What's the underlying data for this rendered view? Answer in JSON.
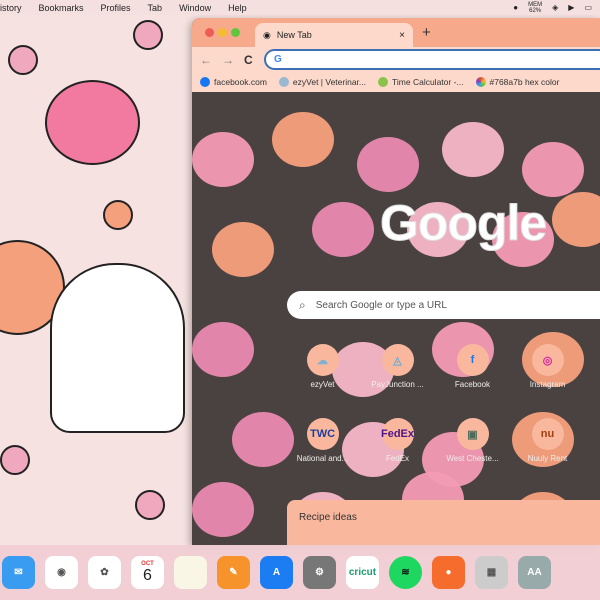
{
  "menubar": {
    "items": [
      "istory",
      "Bookmarks",
      "Profiles",
      "Tab",
      "Window",
      "Help"
    ],
    "mem_label": "MEM",
    "mem_value": "62%"
  },
  "browser": {
    "tab_title": "New Tab",
    "tab_close": "×",
    "new_tab": "+",
    "nav": {
      "back": "←",
      "forward": "→",
      "reload": "C"
    },
    "omnibox": {
      "value": "",
      "icon": "G"
    },
    "bookmarks": [
      {
        "label": "facebook.com",
        "color": "#1877f2"
      },
      {
        "label": "ezyVet | Veterinar...",
        "color": "#9ab8cf"
      },
      {
        "label": "Time Calculator -...",
        "color": "#8bc34a"
      },
      {
        "label": "#768a7b hex color",
        "color": "#e0573a"
      }
    ],
    "logo": "Google",
    "search_placeholder": "Search Google or type a URL",
    "shortcuts": [
      {
        "label": "ezyVet",
        "icon": "☁",
        "color": "#7fb2d0"
      },
      {
        "label": "PayJunction ...",
        "icon": "◬",
        "color": "#6aaed6"
      },
      {
        "label": "Facebook",
        "icon": "f",
        "color": "#1877f2"
      },
      {
        "label": "Instagram",
        "icon": "◎",
        "color": "#d6249f"
      },
      {
        "label": "National and...",
        "icon": "TWC",
        "color": "#1f3f99"
      },
      {
        "label": "FedEx",
        "icon": "FedEx",
        "color": "#4d148c"
      },
      {
        "label": "West Cheste...",
        "icon": "▣",
        "color": "#4c6b5a"
      },
      {
        "label": "Nuuly Rent",
        "icon": "nu",
        "color": "#a0400f"
      }
    ],
    "recipe_title": "Recipe ideas"
  },
  "dock": {
    "apps": [
      {
        "name": "Mail",
        "glyph": "✉",
        "color": "#3a9cf0"
      },
      {
        "name": "Chrome",
        "glyph": "◉",
        "color": "#fff"
      },
      {
        "name": "Photos",
        "glyph": "✿",
        "color": "#fff"
      },
      {
        "name": "Calendar",
        "month": "OCT",
        "day": "6",
        "color": "#fff"
      },
      {
        "name": "Notes",
        "glyph": "",
        "color": "#faf6e6"
      },
      {
        "name": "Pages",
        "glyph": "✎",
        "color": "#f6932b"
      },
      {
        "name": "App Store",
        "glyph": "A",
        "color": "#1c7cf2"
      },
      {
        "name": "System Settings",
        "glyph": "⚙",
        "color": "#777"
      },
      {
        "name": "Cricut",
        "glyph": "cricut",
        "color": "#fff"
      },
      {
        "name": "Spotify",
        "glyph": "≋",
        "color": "#1ed760"
      },
      {
        "name": "Origin",
        "glyph": "●",
        "color": "#f56c2d"
      },
      {
        "name": "Calculator",
        "glyph": "▦",
        "color": "#ccc"
      },
      {
        "name": "Font Book",
        "glyph": "AA",
        "color": "#9aa"
      }
    ]
  }
}
